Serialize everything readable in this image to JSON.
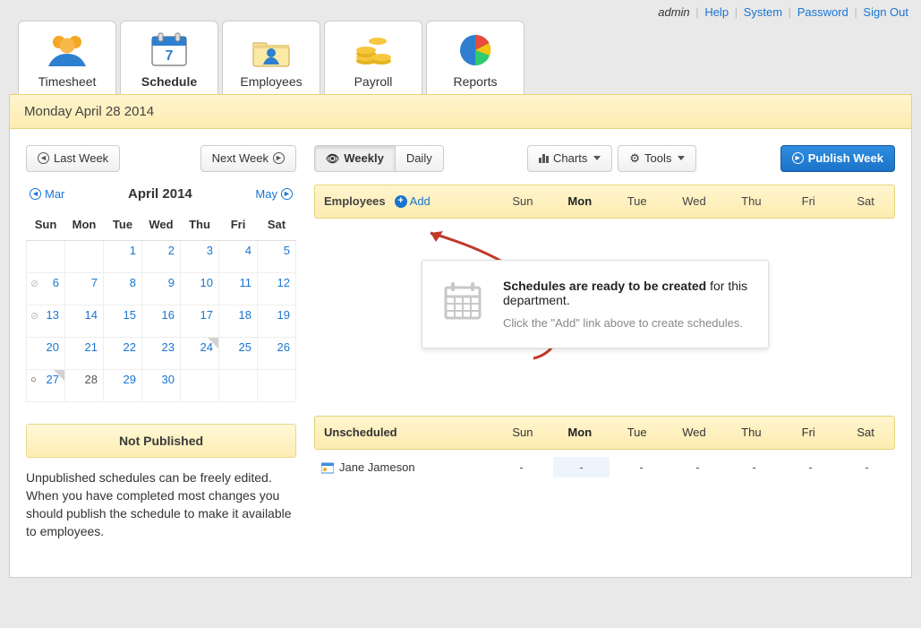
{
  "topbar": {
    "user": "admin",
    "links": [
      "Help",
      "System",
      "Password",
      "Sign Out"
    ]
  },
  "tabs": [
    {
      "id": "timesheet",
      "label": "Timesheet"
    },
    {
      "id": "schedule",
      "label": "Schedule",
      "active": true
    },
    {
      "id": "employees",
      "label": "Employees"
    },
    {
      "id": "payroll",
      "label": "Payroll"
    },
    {
      "id": "reports",
      "label": "Reports"
    }
  ],
  "date_bar": "Monday April 28 2014",
  "nav": {
    "last_week": "Last Week",
    "next_week": "Next Week",
    "view_weekly": "Weekly",
    "view_daily": "Daily",
    "charts": "Charts",
    "tools": "Tools",
    "publish": "Publish Week"
  },
  "calendar": {
    "prev_month": "Mar",
    "title": "April 2014",
    "next_month": "May",
    "dow": [
      "Sun",
      "Mon",
      "Tue",
      "Wed",
      "Thu",
      "Fri",
      "Sat"
    ],
    "weeks": [
      [
        {
          "n": ""
        },
        {
          "n": ""
        },
        {
          "n": 1,
          "link": true
        },
        {
          "n": 2,
          "link": true
        },
        {
          "n": 3,
          "link": true
        },
        {
          "n": 4,
          "link": true
        },
        {
          "n": 5,
          "link": true
        }
      ],
      [
        {
          "n": 6,
          "link": true,
          "mark": "check"
        },
        {
          "n": 7,
          "link": true
        },
        {
          "n": 8,
          "link": true
        },
        {
          "n": 9,
          "link": true
        },
        {
          "n": 10,
          "link": true
        },
        {
          "n": 11,
          "link": true
        },
        {
          "n": 12,
          "link": true
        }
      ],
      [
        {
          "n": 13,
          "link": true,
          "mark": "check"
        },
        {
          "n": 14,
          "link": true
        },
        {
          "n": 15,
          "link": true
        },
        {
          "n": 16,
          "link": true
        },
        {
          "n": 17,
          "link": true
        },
        {
          "n": 18,
          "link": true
        },
        {
          "n": 19,
          "link": true
        }
      ],
      [
        {
          "n": 20,
          "link": true
        },
        {
          "n": 21,
          "link": true
        },
        {
          "n": 22,
          "link": true
        },
        {
          "n": 23,
          "link": true
        },
        {
          "n": 24,
          "link": true,
          "note": true
        },
        {
          "n": 25,
          "link": true
        },
        {
          "n": 26,
          "link": true
        }
      ],
      [
        {
          "n": 27,
          "link": true,
          "mark": "today",
          "note": true
        },
        {
          "n": 28,
          "other": true
        },
        {
          "n": 29,
          "link": true
        },
        {
          "n": 30,
          "link": true
        },
        {
          "n": ""
        },
        {
          "n": ""
        },
        {
          "n": ""
        }
      ]
    ]
  },
  "publish_box": {
    "title": "Not Published",
    "desc": "Unpublished schedules can be freely edited. When you have completed most changes you should publish the schedule to make it available to employees."
  },
  "sched_header": {
    "employees_label": "Employees",
    "add_label": "Add",
    "days": [
      "Sun",
      "Mon",
      "Tue",
      "Wed",
      "Thu",
      "Fri",
      "Sat"
    ],
    "active_day_index": 1
  },
  "callout": {
    "title_strong": "Schedules are ready to be created",
    "title_rest": " for this department.",
    "sub": "Click the \"Add\" link above to create schedules."
  },
  "unscheduled": {
    "label": "Unscheduled",
    "rows": [
      {
        "name": "Jane Jameson",
        "cells": [
          "-",
          "-",
          "-",
          "-",
          "-",
          "-",
          "-"
        ]
      }
    ]
  }
}
